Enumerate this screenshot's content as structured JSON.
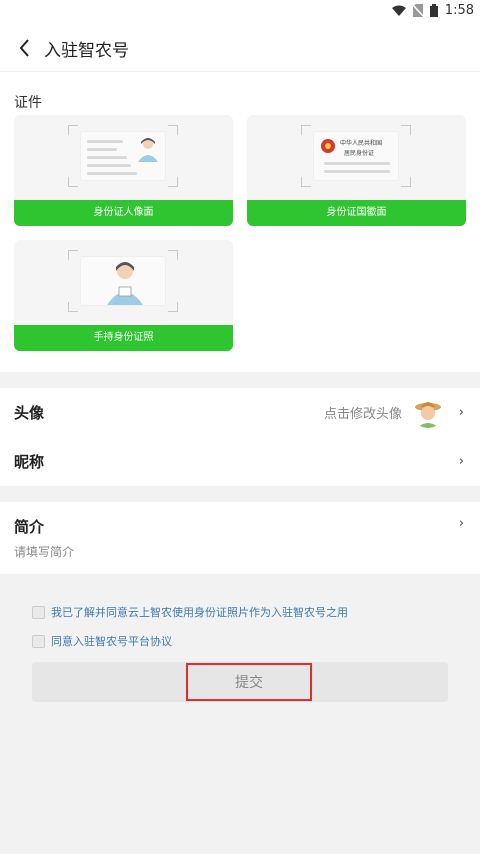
{
  "status_bar": {
    "time": "1:58",
    "icons": [
      "wifi-icon",
      "no-sim-icon",
      "battery-icon"
    ]
  },
  "app_bar": {
    "title": "入驻智农号",
    "back_icon": "chevron-left-icon"
  },
  "certificates": {
    "section_title": "证件",
    "cards": [
      {
        "label": "身份证人像面"
      },
      {
        "label": "身份证国徽面",
        "emblem_text_1": "中华人民共和国",
        "emblem_text_2": "居民身份证"
      },
      {
        "label": "手持身份证照"
      }
    ]
  },
  "profile": {
    "avatar_row": {
      "label": "头像",
      "hint": "点击修改头像"
    },
    "nickname_row": {
      "label": "昵称"
    }
  },
  "intro": {
    "label": "简介",
    "placeholder": "请填写简介"
  },
  "agreements": [
    {
      "text": "我已了解并同意云上智农使用身份证照片作为入驻智农号之用"
    },
    {
      "text": "同意入驻智农号平台协议"
    }
  ],
  "submit": {
    "label": "提交"
  },
  "colors": {
    "accent_green": "#2fc531",
    "highlight_red": "#e02e2e",
    "link_blue": "#3d7bb2"
  }
}
